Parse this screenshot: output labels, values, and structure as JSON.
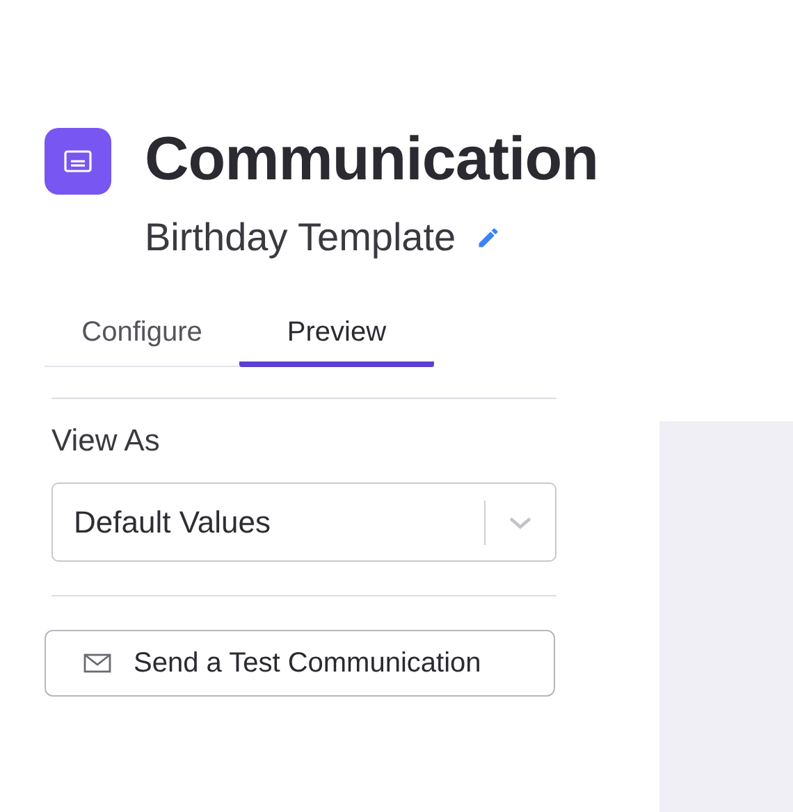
{
  "header": {
    "title": "Communication",
    "subtitle": "Birthday Template"
  },
  "tabs": [
    {
      "label": "Configure",
      "selected": false
    },
    {
      "label": "Preview",
      "selected": true
    }
  ],
  "view_as": {
    "label": "View As",
    "value": "Default Values"
  },
  "test_button": {
    "label": "Send a Test Communication"
  }
}
